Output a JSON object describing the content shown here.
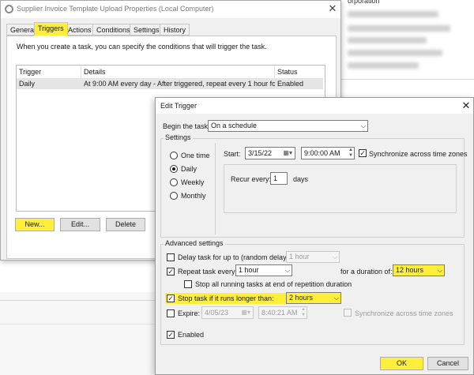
{
  "background": {
    "company_text": "orporation"
  },
  "properties_window": {
    "title": "Supplier Invoice Template Upload Properties (Local Computer)",
    "close": "✕",
    "tabs": [
      "General",
      "Triggers",
      "Actions",
      "Conditions",
      "Settings",
      "History"
    ],
    "active_tab": "Triggers",
    "intro_text": "When you create a task, you can specify the conditions that will trigger the task.",
    "table": {
      "headers": [
        "Trigger",
        "Details",
        "Status"
      ],
      "rows": [
        {
          "trigger": "Daily",
          "details": "At 9:00 AM every day - After triggered, repeat every 1 hour for a ...",
          "status": "Enabled"
        }
      ]
    },
    "buttons": {
      "new": "New...",
      "edit": "Edit...",
      "delete": "Delete"
    }
  },
  "edit_trigger": {
    "title": "Edit Trigger",
    "close": "✕",
    "begin_task_label": "Begin the task:",
    "begin_task_value": "On a schedule",
    "settings_label": "Settings",
    "schedule_options": [
      "One time",
      "Daily",
      "Weekly",
      "Monthly"
    ],
    "selected_schedule": "Daily",
    "start_label": "Start:",
    "start_date": "3/15/22",
    "start_time": "9:00:00 AM",
    "sync_time_zones": "Synchronize across time zones",
    "recur_label": "Recur every:",
    "recur_value": "1",
    "recur_unit": "days",
    "advanced_label": "Advanced settings",
    "delay_label": "Delay task for up to (random delay):",
    "delay_value": "1 hour",
    "repeat_label": "Repeat task every:",
    "repeat_value": "1 hour",
    "duration_label": "for a duration of:",
    "duration_value": "12 hours",
    "stop_running_label": "Stop all running tasks at end of repetition duration",
    "stop_longer_label": "Stop task if it runs longer than:",
    "stop_longer_value": "2 hours",
    "expire_label": "Expire:",
    "expire_date": "4/05/23",
    "expire_time": "8:40:21 AM",
    "expire_sync": "Synchronize across time zones",
    "enabled_label": "Enabled",
    "ok": "OK",
    "cancel": "Cancel",
    "checkmark": "✓",
    "dropdown_arrow": "⌵"
  },
  "colors": {
    "highlight": "#ffef3a",
    "selected_row": "#e5e5e5"
  }
}
